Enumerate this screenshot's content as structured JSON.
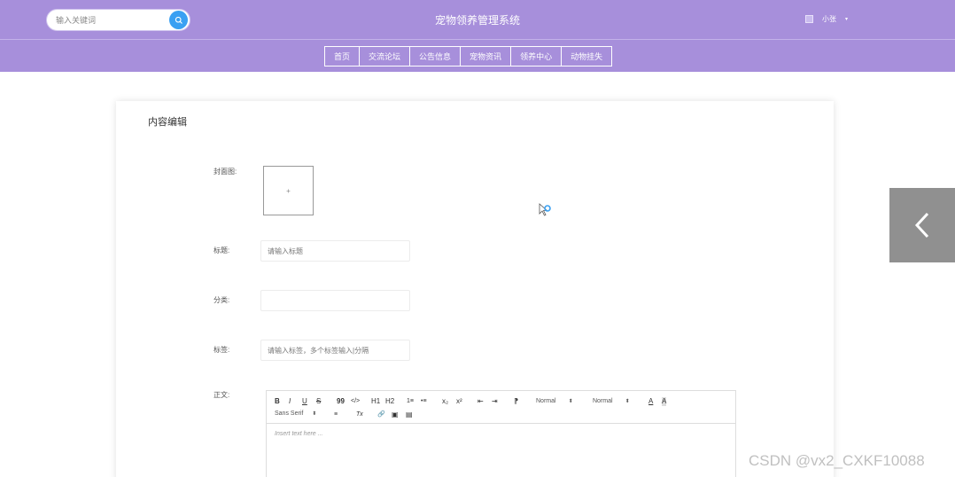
{
  "header": {
    "search_placeholder": "输入关键词",
    "title": "宠物领养管理系统",
    "user_name": "小张",
    "caret": "▾",
    "bg_color": "#a78fdb",
    "search_btn_color": "#3aa0f2"
  },
  "nav": {
    "items": [
      {
        "label": "首页"
      },
      {
        "label": "交流论坛"
      },
      {
        "label": "公告信息"
      },
      {
        "label": "宠物资讯"
      },
      {
        "label": "领养中心"
      },
      {
        "label": "动物挂失"
      }
    ]
  },
  "form": {
    "card_title": "内容编辑",
    "cover_label": "封面图:",
    "cover_plus": "+",
    "title_label": "标题:",
    "title_placeholder": "请输入标题",
    "category_label": "分类:",
    "category_value": "",
    "tags_label": "标签:",
    "tags_placeholder": "请输入标签，多个标签输入|分隔",
    "content_label": "正文:"
  },
  "editor": {
    "bold": "B",
    "italic": "I",
    "underline": "U",
    "strike": "S",
    "quote": "99",
    "code": "</>",
    "h1": "H1",
    "h2": "H2",
    "ordered_list": "1≡",
    "bullet_list": "•≡",
    "subscript": "x₂",
    "superscript": "x²",
    "outdent": "⇤",
    "indent": "⇥",
    "rtl": "⁋",
    "size_select": "Normal",
    "header_select": "Normal",
    "color": "A",
    "background": "A",
    "font_select": "Sans Serif",
    "align": "≡",
    "clean": "Tx",
    "link": "🔗",
    "image": "▣",
    "video": "▤",
    "select_arrow": "⬍",
    "placeholder": "Insert text here ..."
  },
  "watermark": "CSDN @vx2_CXKF10088"
}
